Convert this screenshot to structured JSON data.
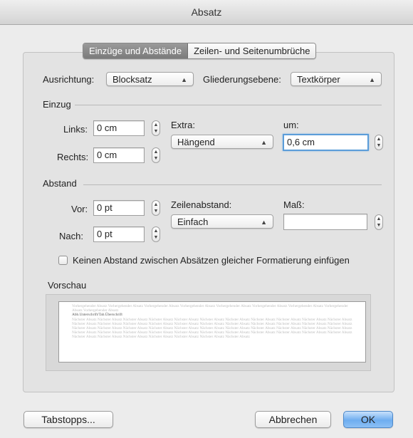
{
  "window": {
    "title": "Absatz"
  },
  "tabs": [
    {
      "label": "Einzüge und Abstände",
      "active": true
    },
    {
      "label": "Zeilen- und Seitenumbrüche",
      "active": false
    }
  ],
  "alignment": {
    "label": "Ausrichtung:",
    "value": "Blocksatz"
  },
  "outline": {
    "label": "Gliederungsebene:",
    "value": "Textkörper"
  },
  "indent": {
    "heading": "Einzug",
    "left_label": "Links:",
    "left_value": "0 cm",
    "right_label": "Rechts:",
    "right_value": "0 cm",
    "special_label": "Extra:",
    "special_value": "Hängend",
    "by_label": "um:",
    "by_value": "0,6 cm"
  },
  "spacing": {
    "heading": "Abstand",
    "before_label": "Vor:",
    "before_value": "0 pt",
    "after_label": "Nach:",
    "after_value": "0 pt",
    "line_spacing_label": "Zeilenabstand:",
    "line_spacing_value": "Einfach",
    "at_label": "Maß:",
    "at_value": ""
  },
  "no_space_checkbox": {
    "label": "Keinen Abstand zwischen Absätzen gleicher Formatierung einfügen",
    "checked": false
  },
  "preview": {
    "heading": "Vorschau",
    "previous_text": "Vorhergehender Absatz Vorhergehender Absatz Vorhergehender Absatz Vorhergehender Absatz Vorhergehender Absatz Vorhergehender Absatz Vorhergehender Absatz Vorhergehender Absatz Vorhergehender Absatz",
    "current_text": "Abb.Unterschrift/Tab.Überschrift",
    "next_text": "Nächster Absatz Nächster Absatz Nächster Absatz Nächster Absatz Nächster Absatz Nächster Absatz Nächster Absatz Nächster Absatz Nächster Absatz Nächster Absatz Nächster Absatz Nächster Absatz Nächster Absatz Nächster Absatz Nächster Absatz Nächster Absatz Nächster Absatz Nächster Absatz Nächster Absatz Nächster Absatz Nächster Absatz Nächster Absatz Nächster Absatz Nächster Absatz Nächster Absatz Nächster Absatz Nächster Absatz Nächster Absatz Nächster Absatz Nächster Absatz Nächster Absatz Nächster Absatz Nächster Absatz Nächster Absatz Nächster Absatz Nächster Absatz Nächster Absatz Nächster Absatz Nächster Absatz Nächster Absatz Nächster Absatz Nächster Absatz Nächster Absatz Nächster Absatz Nächster Absatz Nächster Absatz Nächster Absatz Nächster Absatz Nächster Absatz Nächster Absatz Nächster Absatz"
  },
  "buttons": {
    "tabs": "Tabstopps...",
    "cancel": "Abbrechen",
    "ok": "OK"
  },
  "icons": {
    "select_arrows": "updown-chevrons-icon",
    "stepper": "stepper-arrows-icon"
  },
  "colors": {
    "accent": "#5b9dd9",
    "default_button": "#6eadf0"
  }
}
